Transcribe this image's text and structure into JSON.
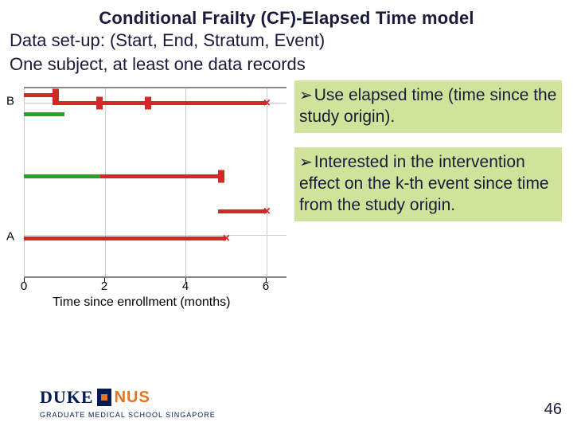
{
  "title": "Conditional Frailty (CF)-Elapsed Time model",
  "subtitle1": "Data set-up: (Start, End, Stratum, Event)",
  "subtitle2": "One subject, at least one data records",
  "bullets": {
    "b1": "Use elapsed time (time since the study origin).",
    "b2": "Interested in the intervention effect on the k-th event since time from the study origin."
  },
  "axis": {
    "xlabel": "Time since enrollment (months)",
    "yB": "B",
    "yA": "A",
    "x0": "0",
    "x2": "2",
    "x4": "4",
    "x6": "6"
  },
  "logo": {
    "l1": "DUKE",
    "l2": "NUS",
    "sub": "GRADUATE MEDICAL SCHOOL SINGAPORE"
  },
  "page": "46",
  "chart_data": {
    "type": "line",
    "xlabel": "Time since enrollment (months)",
    "ylabel": "",
    "xlim": [
      0,
      6.5
    ],
    "subjects": [
      {
        "id": "B",
        "segments": [
          {
            "color": "red",
            "start": 0.0,
            "end": 0.7,
            "end_marker": "event"
          },
          {
            "color": "red",
            "start": 0.7,
            "end": 1.8,
            "end_marker": "event"
          },
          {
            "color": "green",
            "start": 0.0,
            "end": 1.0,
            "end_marker": "none"
          },
          {
            "color": "red",
            "start": 1.8,
            "end": 3.0,
            "end_marker": "event"
          },
          {
            "color": "red",
            "start": 3.0,
            "end": 6.0,
            "end_marker": "censor"
          }
        ]
      },
      {
        "id": "A",
        "segments": [
          {
            "color": "green",
            "start": 0.0,
            "end": 1.9,
            "end_marker": "none"
          },
          {
            "color": "red",
            "start": 1.9,
            "end": 4.8,
            "end_marker": "event"
          },
          {
            "color": "red",
            "start": 4.8,
            "end": 6.0,
            "end_marker": "censor"
          },
          {
            "color": "red",
            "start": 0.0,
            "end": 5.0,
            "end_marker": "censor"
          }
        ]
      }
    ]
  }
}
